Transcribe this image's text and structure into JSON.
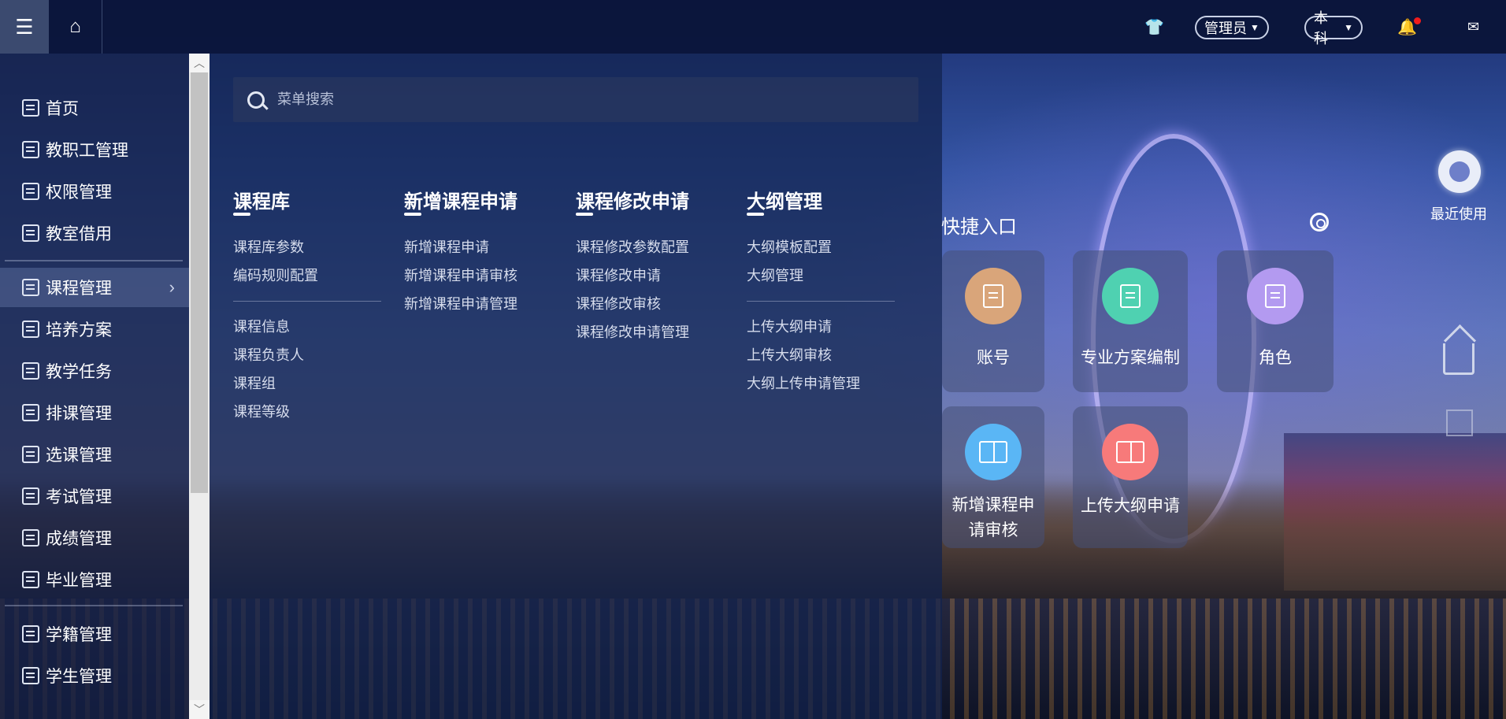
{
  "topbar": {
    "menu_icon": "hamburger-icon",
    "home_icon": "home-icon",
    "theme_icon": "shirt-icon",
    "role_label": "管理员",
    "level_label": "本科",
    "bell_icon": "bell-icon",
    "mail_icon": "mail-icon",
    "notification_dot_color": "#f01c1c"
  },
  "sidebar": {
    "items": [
      {
        "label": "首页"
      },
      {
        "label": "教职工管理"
      },
      {
        "label": "权限管理"
      },
      {
        "label": "教室借用"
      },
      {
        "label": "课程管理"
      },
      {
        "label": "培养方案"
      },
      {
        "label": "教学任务"
      },
      {
        "label": "排课管理"
      },
      {
        "label": "选课管理"
      },
      {
        "label": "考试管理"
      },
      {
        "label": "成绩管理"
      },
      {
        "label": "毕业管理"
      },
      {
        "label": "学籍管理"
      },
      {
        "label": "学生管理"
      }
    ],
    "active_index": 4
  },
  "search": {
    "placeholder": "菜单搜索"
  },
  "menu_columns": [
    {
      "title": "课程库",
      "group1": [
        "课程库参数",
        "编码规则配置"
      ],
      "group2": [
        "课程信息",
        "课程负责人",
        "课程组",
        "课程等级"
      ]
    },
    {
      "title": "新增课程申请",
      "group1": [
        "新增课程申请",
        "新增课程申请审核",
        "新增课程申请管理"
      ]
    },
    {
      "title": "课程修改申请",
      "group1": [
        "课程修改参数配置",
        "课程修改申请",
        "课程修改审核",
        "课程修改申请管理"
      ]
    },
    {
      "title": "大纲管理",
      "group1": [
        "大纲模板配置",
        "大纲管理"
      ],
      "group2": [
        "上传大纲申请",
        "上传大纲审核",
        "大纲上传申请管理"
      ]
    }
  ],
  "quick": {
    "title": "快捷入口",
    "cards": [
      {
        "label": "账号",
        "color": "#d9a57a"
      },
      {
        "label": "专业方案编制",
        "color": "#4fd1b1"
      },
      {
        "label": "角色",
        "color": "#b39af0"
      },
      {
        "label": "新增课程申请审核",
        "color": "#5ab6f5"
      },
      {
        "label": "上传大纲申请",
        "color": "#f77a7a"
      }
    ],
    "recent_label": "最近使用"
  }
}
